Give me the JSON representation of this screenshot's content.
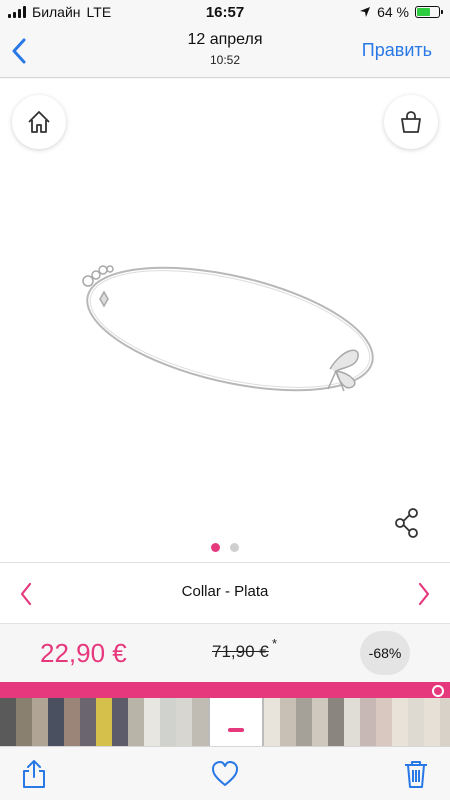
{
  "status_bar": {
    "carrier": "Билайн",
    "network": "LTE",
    "time": "16:57",
    "battery": "64 %",
    "battery_level": 0.64
  },
  "nav": {
    "title": "12 апреля",
    "subtitle": "10:52",
    "edit_label": "Править"
  },
  "product": {
    "name": "Collar - Plata",
    "price": "22,90 €",
    "old_price": "71,90 €",
    "old_price_mark": "*",
    "discount": "-68%",
    "image_icon": "silver-necklace-with-bow",
    "carousel": {
      "pages": 2,
      "active": 0
    }
  },
  "thumbnail_strip": {
    "accent": "#e6387c",
    "thumbs": [
      "#5a5a5a",
      "#8a8070",
      "#b0a595",
      "#4a5060",
      "#9a8578",
      "#6b6570",
      "#d4c04a",
      "#5c5c6a",
      "#b8b4a8",
      "#e8e6e0",
      "#cfd2cd",
      "#d8d6d0",
      "#c0bcb4",
      "#ffffff",
      "#e8e4dc",
      "#c8c0b5",
      "#a5a098",
      "#cfc8be",
      "#8a857f",
      "#e0dcd6",
      "#c8b8b5",
      "#d8c8c0",
      "#e8e2d8",
      "#dedad2",
      "#e6e0d6",
      "#d8d2c8",
      "#e2ddd4",
      "#f0eee8"
    ]
  },
  "colors": {
    "accent": "#e6387c",
    "link": "#2878e6"
  },
  "icons": {
    "back": "chevron-left-icon",
    "home": "home-icon",
    "cart": "shopping-bag-icon",
    "share": "share-icon",
    "toolbar": [
      "share-icon",
      "heart-icon",
      "trash-icon"
    ]
  }
}
